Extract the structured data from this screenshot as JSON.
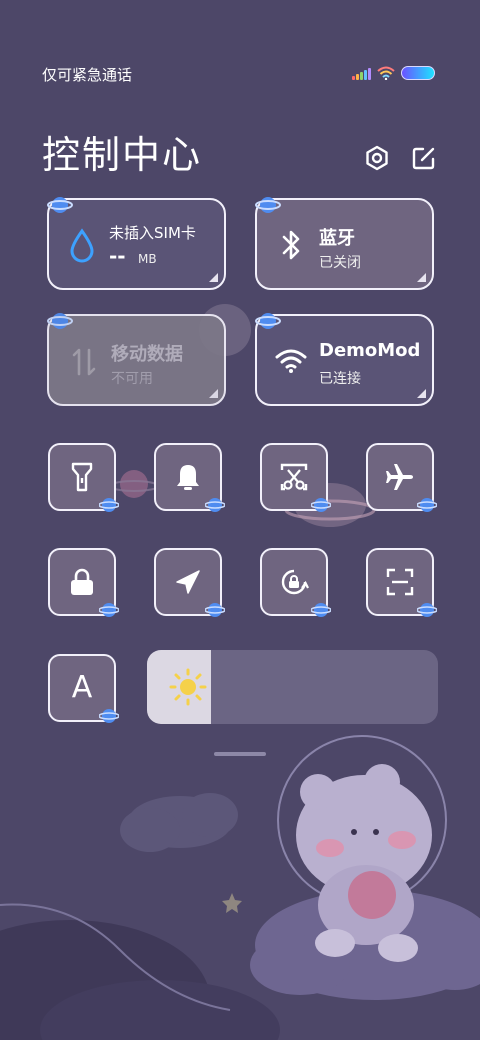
{
  "status_bar": {
    "carrier_text": "仅可紧急通话"
  },
  "header": {
    "title": "控制中心",
    "settings_icon": "settings-icon",
    "edit_icon": "edit-icon"
  },
  "tiles": {
    "sim": {
      "title": "未插入SIM卡",
      "value": "--",
      "unit": "MB"
    },
    "bluetooth": {
      "title": "蓝牙",
      "status": "已关闭"
    },
    "mobile_data": {
      "title": "移动数据",
      "status": "不可用"
    },
    "wifi": {
      "title": "DemoMod",
      "status": "已连接"
    }
  },
  "toggles": [
    {
      "name": "flashlight-toggle",
      "icon": "flashlight-icon"
    },
    {
      "name": "notification-toggle",
      "icon": "bell-icon"
    },
    {
      "name": "screenshot-toggle",
      "icon": "scissors-icon"
    },
    {
      "name": "airplane-toggle",
      "icon": "airplane-icon"
    },
    {
      "name": "lock-screen-toggle",
      "icon": "lock-icon"
    },
    {
      "name": "location-toggle",
      "icon": "location-arrow-icon"
    },
    {
      "name": "rotation-lock-toggle",
      "icon": "rotation-lock-icon"
    },
    {
      "name": "scanner-toggle",
      "icon": "scan-icon"
    },
    {
      "name": "font-size-toggle",
      "icon": "font-icon",
      "label": "A"
    }
  ],
  "brightness": {
    "level": 0.22,
    "icon": "sun-icon"
  },
  "colors": {
    "background": "#4d4768",
    "tile": "#6f6580",
    "planet": "#4f8cf0"
  }
}
